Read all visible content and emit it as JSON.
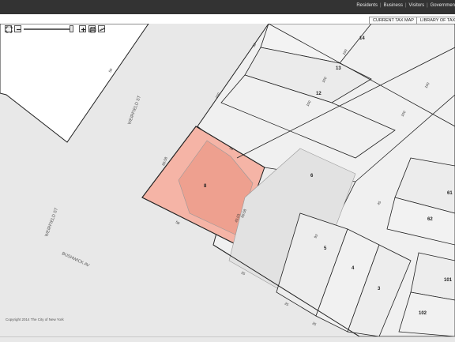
{
  "top_nav": [
    "Residents",
    "Business",
    "Visitors",
    "Governmen"
  ],
  "tabs": {
    "current": "CURRENT TAX MAP",
    "library": "LIBRARY OF TAX M"
  },
  "map": {
    "streets": [
      "WEIRFIELD ST",
      "WEIRFIELD ST",
      "BUSHWICK AV"
    ],
    "lots": [
      "14",
      "13",
      "12",
      "8",
      "6",
      "5",
      "4",
      "3",
      "61",
      "62",
      "101",
      "102"
    ],
    "dims": [
      "50",
      "100",
      "100",
      "50",
      "100",
      "100",
      "100",
      "100",
      "58",
      "60.58",
      "43.03",
      "60.58",
      "58",
      "100",
      "100",
      "93",
      "93",
      "100",
      "25",
      "45",
      "25",
      "25",
      "25",
      "25",
      "25",
      "25",
      "25",
      "25",
      "25",
      "100",
      "100",
      "100",
      "42",
      "40",
      "100",
      "100",
      "90",
      "40",
      "30",
      "15.03",
      "50"
    ],
    "selected_lot_color": "#f5b4a6",
    "copyright": "Copyright 2014 The City of New York"
  },
  "controls": [
    "zoom-extent-icon",
    "zoom-out-icon",
    "zoom-in-icon",
    "print-icon",
    "measure-icon"
  ]
}
